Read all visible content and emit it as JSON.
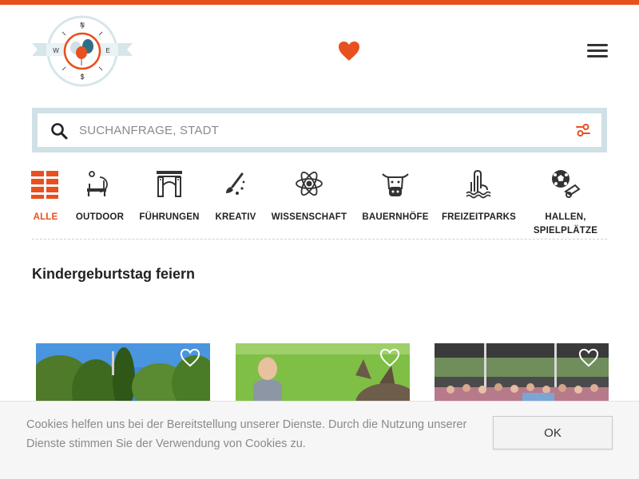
{
  "colors": {
    "accent": "#e8501f",
    "search_frame": "#cfe1e6",
    "text": "#222222",
    "muted": "#8a8a8a"
  },
  "header": {
    "logo": {
      "letters": {
        "n": "N",
        "e": "E",
        "s": "S",
        "w": "W"
      }
    },
    "favorites_icon": "heart-icon",
    "menu_icon": "hamburger-menu-icon"
  },
  "search": {
    "placeholder": "SUCHANFRAGE, STADT",
    "value": "",
    "search_icon": "search-icon",
    "filter_icon": "filter-sliders-icon"
  },
  "categories": [
    {
      "label": "ALLE",
      "icon": "grid-all-icon",
      "active": true
    },
    {
      "label": "OUTDOOR",
      "icon": "bench-outdoor-icon",
      "active": false
    },
    {
      "label": "FÜHRUNGEN",
      "icon": "gate-tour-icon",
      "active": false
    },
    {
      "label": "KREATIV",
      "icon": "paintbrush-icon",
      "active": false
    },
    {
      "label": "WISSENSCHAFT",
      "icon": "atom-icon",
      "active": false
    },
    {
      "label": "BAUERNHÖFE",
      "icon": "cow-icon",
      "active": false
    },
    {
      "label": "FREIZEITPARKS",
      "icon": "waterslide-icon",
      "active": false
    },
    {
      "label": "HALLEN, SPIELPLÄTZE",
      "icon": "ball-whistle-icon",
      "active": false
    }
  ],
  "main": {
    "section_title": "Kindergeburtstag feiern"
  },
  "cards": [
    {
      "image": "trees-park-photo",
      "favorite_icon": "heart-outline-icon"
    },
    {
      "image": "child-donkey-photo",
      "favorite_icon": "heart-outline-icon"
    },
    {
      "image": "group-tent-photo",
      "favorite_icon": "heart-outline-icon"
    }
  ],
  "cookie_banner": {
    "text": "Cookies helfen uns bei der Bereitstellung unserer Dienste. Durch die Nutzung unserer Dienste stimmen Sie der Verwendung von Cookies zu.",
    "button_label": "OK"
  }
}
